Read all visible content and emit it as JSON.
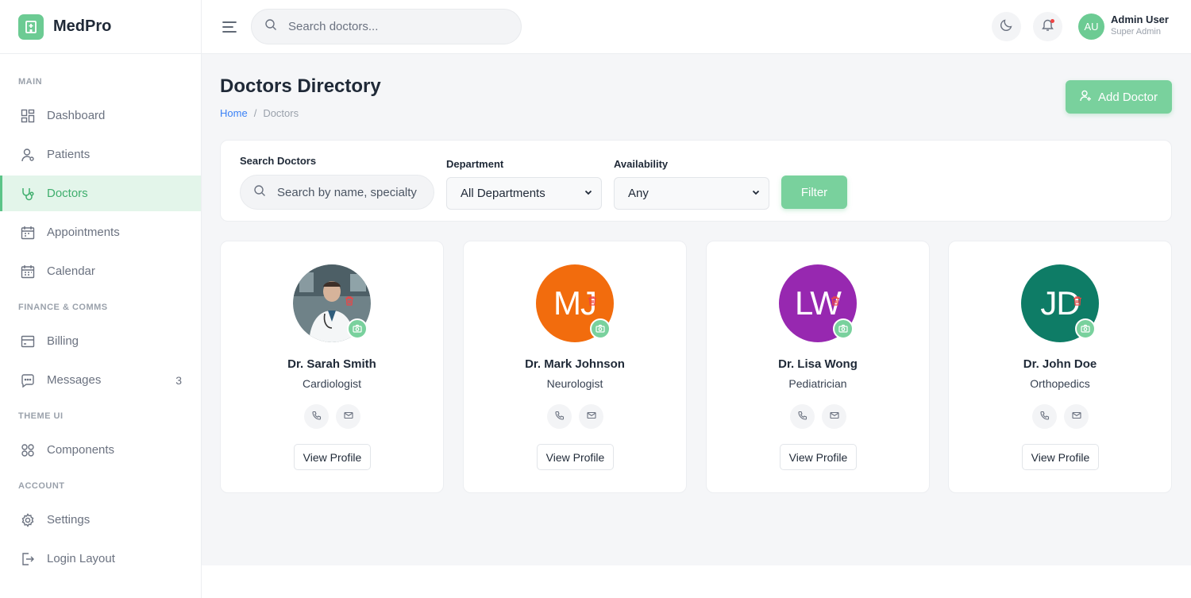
{
  "brand": {
    "name": "MedPro"
  },
  "sidebar": {
    "sections": [
      {
        "title": "MAIN"
      },
      {
        "title": "FINANCE & COMMS"
      },
      {
        "title": "THEME UI"
      },
      {
        "title": "ACCOUNT"
      }
    ],
    "items": [
      {
        "label": "Dashboard",
        "icon": "grid-icon"
      },
      {
        "label": "Patients",
        "icon": "user-icon"
      },
      {
        "label": "Doctors",
        "icon": "stethoscope-icon",
        "active": true
      },
      {
        "label": "Appointments",
        "icon": "calendar-icon"
      },
      {
        "label": "Calendar",
        "icon": "calendar-icon"
      },
      {
        "label": "Billing",
        "icon": "card-icon"
      },
      {
        "label": "Messages",
        "icon": "chat-icon",
        "badge": "3"
      },
      {
        "label": "Components",
        "icon": "components-icon"
      },
      {
        "label": "Settings",
        "icon": "gear-icon"
      },
      {
        "label": "Login Layout",
        "icon": "logout-icon"
      }
    ]
  },
  "header": {
    "search_placeholder": "Search doctors...",
    "user": {
      "initials": "AU",
      "name": "Admin User",
      "role": "Super Admin"
    }
  },
  "page": {
    "title": "Doctors Directory",
    "breadcrumb": [
      "Home",
      "/",
      "Doctors"
    ],
    "add_button": "Add Doctor"
  },
  "filters": {
    "search_label": "Search Doctors",
    "search_placeholder": "Search by name, specialty",
    "department_label": "Department",
    "department_value": "All Departments",
    "availability_label": "Availability",
    "availability_value": "Any",
    "filter_button": "Filter"
  },
  "doctors": [
    {
      "name": "Dr. Sarah Smith",
      "specialty": "Cardiologist",
      "initials": "",
      "color": "#7a8a8e",
      "photo": true,
      "view": "View Profile"
    },
    {
      "name": "Dr. Mark Johnson",
      "specialty": "Neurologist",
      "initials": "MJ",
      "color": "#f26c0d",
      "view": "View Profile"
    },
    {
      "name": "Dr. Lisa Wong",
      "specialty": "Pediatrician",
      "initials": "LW",
      "color": "#9728b0",
      "view": "View Profile"
    },
    {
      "name": "Dr. John Doe",
      "specialty": "Orthopedics",
      "initials": "JD",
      "color": "#0e7c66",
      "view": "View Profile"
    }
  ],
  "colors": {
    "accent": "#6ccb93",
    "active_bg": "#e3f5ea",
    "link": "#3b82f6",
    "danger": "#ef4444"
  }
}
